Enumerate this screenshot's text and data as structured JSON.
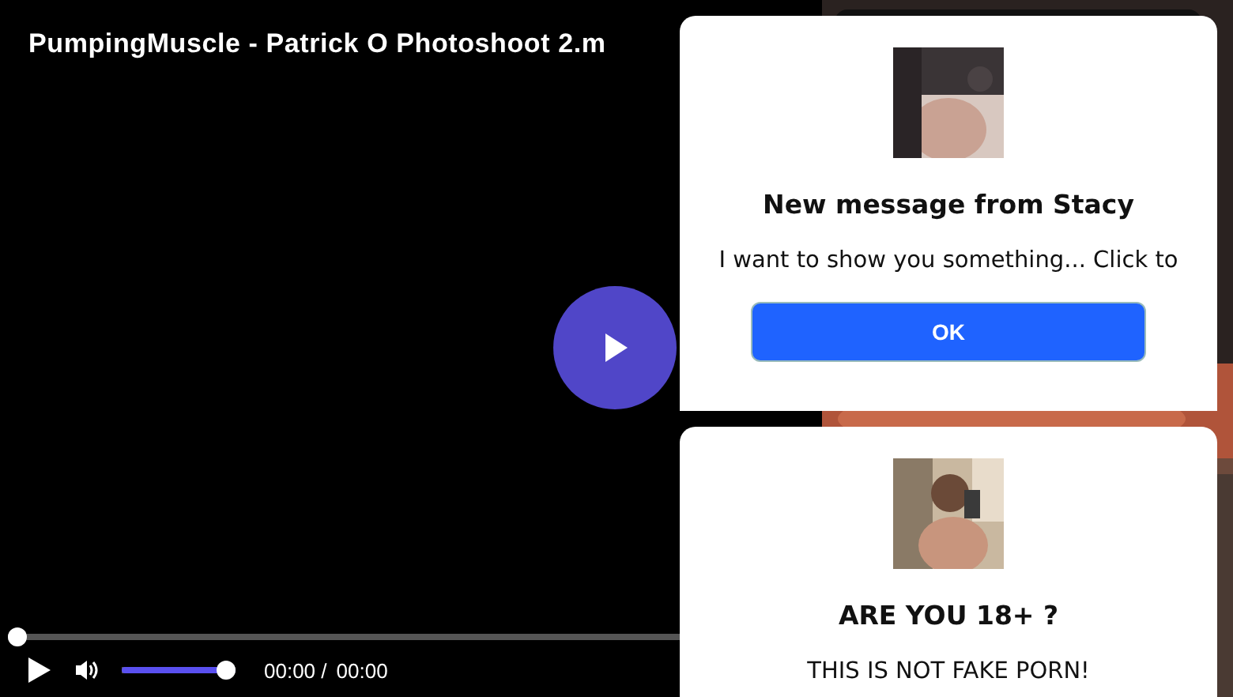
{
  "video": {
    "title": "PumpingMuscle - Patrick O Photoshoot 2.m",
    "progress": {
      "level": 0
    },
    "volume": {
      "level": 1
    },
    "current_time": "00:00 /",
    "duration": "00:00"
  },
  "popups": [
    {
      "kind": "message",
      "heading": "New message from Stacy",
      "text": "I want to show you something... Click to",
      "button": "OK"
    },
    {
      "kind": "age",
      "heading": "ARE YOU 18+ ?",
      "text": "THIS IS NOT FAKE PORN!"
    }
  ]
}
